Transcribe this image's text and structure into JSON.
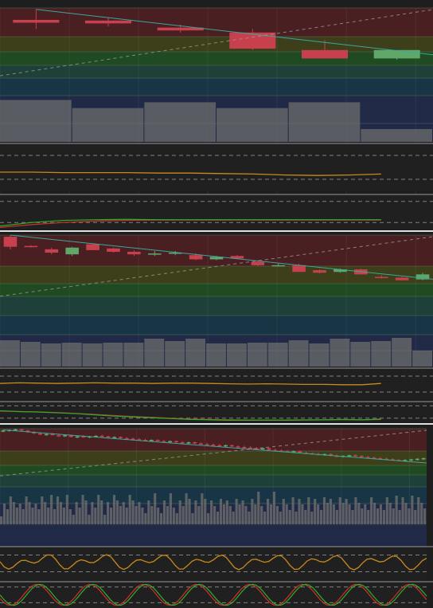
{
  "theme": {
    "background": "#1e1e1e",
    "divider": "#e0e0e0",
    "bull": "#5fa86a",
    "bear": "#c8404e",
    "trend_line": "#3aa79c",
    "ray_line": "#9a9a9a",
    "oscillator": "#c98a1c",
    "signal_red": "#d0302c",
    "signal_green": "#2fae2a",
    "volume_up": "#6e6e6e",
    "volume_down": "#3a3a4a",
    "zone_colors": [
      "#4a1f22",
      "#3d3f1a",
      "#1f4a22",
      "#1e4038",
      "#173545",
      "#202a46"
    ]
  },
  "chart_data": [
    {
      "name": "panel-1",
      "type": "candlestick",
      "period": "long",
      "price_range": [
        0,
        100
      ],
      "candles": [
        {
          "o": 83,
          "h": 98,
          "l": 70,
          "c": 79
        },
        {
          "o": 82,
          "h": 87,
          "l": 74,
          "c": 78
        },
        {
          "o": 72,
          "h": 76,
          "l": 65,
          "c": 68
        },
        {
          "o": 65,
          "h": 70,
          "l": 40,
          "c": 42
        },
        {
          "o": 40,
          "h": 54,
          "l": 28,
          "c": 28
        },
        {
          "o": 28,
          "h": 40,
          "l": 26,
          "c": 40
        }
      ],
      "volume": [
        72,
        58,
        68,
        58,
        68,
        22
      ],
      "oscillator": [
        40,
        40,
        39,
        39,
        39,
        38,
        38,
        37,
        36,
        34,
        33,
        34,
        36
      ],
      "signal_fast": [
        10,
        20,
        26,
        28,
        29,
        28,
        28,
        28,
        28,
        28,
        28,
        28,
        28
      ],
      "signal_slow": [
        6,
        14,
        20,
        24,
        26,
        27,
        27,
        27,
        27,
        27,
        27,
        27,
        27
      ]
    },
    {
      "name": "panel-2",
      "type": "candlestick",
      "period": "medium",
      "price_range": [
        0,
        100
      ],
      "candles": [
        {
          "o": 98,
          "h": 100,
          "l": 83,
          "c": 86
        },
        {
          "o": 87,
          "h": 88,
          "l": 85,
          "c": 86
        },
        {
          "o": 83,
          "h": 85,
          "l": 77,
          "c": 79
        },
        {
          "o": 77,
          "h": 86,
          "l": 75,
          "c": 85
        },
        {
          "o": 89,
          "h": 90,
          "l": 82,
          "c": 82
        },
        {
          "o": 84,
          "h": 85,
          "l": 79,
          "c": 80
        },
        {
          "o": 80,
          "h": 82,
          "l": 75,
          "c": 77
        },
        {
          "o": 78,
          "h": 81,
          "l": 75,
          "c": 78
        },
        {
          "o": 79,
          "h": 81,
          "l": 76,
          "c": 79
        },
        {
          "o": 76,
          "h": 78,
          "l": 70,
          "c": 71
        },
        {
          "o": 71,
          "h": 75,
          "l": 70,
          "c": 74
        },
        {
          "o": 75,
          "h": 76,
          "l": 71,
          "c": 72
        },
        {
          "o": 68,
          "h": 70,
          "l": 63,
          "c": 64
        },
        {
          "o": 64,
          "h": 66,
          "l": 63,
          "c": 64
        },
        {
          "o": 64,
          "h": 66,
          "l": 56,
          "c": 56
        },
        {
          "o": 58,
          "h": 59,
          "l": 54,
          "c": 55
        },
        {
          "o": 56,
          "h": 60,
          "l": 55,
          "c": 59
        },
        {
          "o": 59,
          "h": 60,
          "l": 53,
          "c": 53
        },
        {
          "o": 50,
          "h": 52,
          "l": 48,
          "c": 49
        },
        {
          "o": 49,
          "h": 50,
          "l": 46,
          "c": 46
        },
        {
          "o": 47,
          "h": 55,
          "l": 46,
          "c": 53
        }
      ],
      "volume": [
        66,
        62,
        58,
        60,
        58,
        60,
        60,
        70,
        64,
        70,
        58,
        58,
        60,
        60,
        66,
        58,
        70,
        62,
        64,
        72,
        40
      ],
      "oscillator": [
        52,
        54,
        53,
        52,
        53,
        54,
        53,
        53,
        52,
        53,
        53,
        52,
        51,
        50,
        51,
        50,
        49,
        49,
        48,
        48,
        52
      ],
      "signal_fast": [
        56,
        52,
        50,
        46,
        42,
        36,
        30,
        26,
        22,
        18,
        14,
        12,
        10,
        10,
        10,
        10,
        11,
        12,
        14,
        12,
        16
      ],
      "signal_slow": [
        54,
        52,
        50,
        47,
        43,
        38,
        33,
        28,
        24,
        20,
        16,
        14,
        12,
        11,
        11,
        11,
        12,
        12,
        13,
        12,
        14
      ]
    },
    {
      "name": "panel-3",
      "type": "candlestick",
      "period": "short",
      "price_range": [
        0,
        100
      ],
      "candles": [
        {
          "o": 96,
          "h": 98,
          "l": 94,
          "c": 97
        },
        {
          "o": 97,
          "h": 99,
          "l": 95,
          "c": 98
        },
        {
          "o": 98,
          "h": 100,
          "l": 96,
          "c": 99
        },
        {
          "o": 99,
          "h": 100,
          "l": 96,
          "c": 97
        },
        {
          "o": 97,
          "h": 98,
          "l": 93,
          "c": 94
        },
        {
          "o": 94,
          "h": 96,
          "l": 91,
          "c": 92
        },
        {
          "o": 92,
          "h": 94,
          "l": 89,
          "c": 90
        },
        {
          "o": 90,
          "h": 92,
          "l": 88,
          "c": 91
        },
        {
          "o": 91,
          "h": 93,
          "l": 89,
          "c": 89
        },
        {
          "o": 89,
          "h": 91,
          "l": 86,
          "c": 87
        },
        {
          "o": 87,
          "h": 90,
          "l": 86,
          "c": 89
        },
        {
          "o": 89,
          "h": 90,
          "l": 85,
          "c": 86
        },
        {
          "o": 86,
          "h": 88,
          "l": 84,
          "c": 87
        },
        {
          "o": 87,
          "h": 89,
          "l": 85,
          "c": 86
        },
        {
          "o": 86,
          "h": 88,
          "l": 84,
          "c": 87
        },
        {
          "o": 87,
          "h": 89,
          "l": 85,
          "c": 88
        },
        {
          "o": 88,
          "h": 90,
          "l": 86,
          "c": 87
        },
        {
          "o": 87,
          "h": 88,
          "l": 84,
          "c": 85
        },
        {
          "o": 85,
          "h": 87,
          "l": 83,
          "c": 86
        },
        {
          "o": 86,
          "h": 87,
          "l": 83,
          "c": 84
        },
        {
          "o": 84,
          "h": 86,
          "l": 82,
          "c": 83
        },
        {
          "o": 83,
          "h": 85,
          "l": 81,
          "c": 82
        },
        {
          "o": 82,
          "h": 84,
          "l": 80,
          "c": 81
        },
        {
          "o": 81,
          "h": 83,
          "l": 79,
          "c": 80
        },
        {
          "o": 80,
          "h": 82,
          "l": 78,
          "c": 81
        },
        {
          "o": 81,
          "h": 82,
          "l": 78,
          "c": 79
        },
        {
          "o": 79,
          "h": 81,
          "l": 77,
          "c": 78
        },
        {
          "o": 78,
          "h": 80,
          "l": 76,
          "c": 79
        },
        {
          "o": 79,
          "h": 80,
          "l": 76,
          "c": 77
        },
        {
          "o": 77,
          "h": 79,
          "l": 75,
          "c": 76
        },
        {
          "o": 76,
          "h": 78,
          "l": 74,
          "c": 77
        },
        {
          "o": 77,
          "h": 78,
          "l": 74,
          "c": 75
        },
        {
          "o": 75,
          "h": 77,
          "l": 73,
          "c": 74
        },
        {
          "o": 74,
          "h": 76,
          "l": 72,
          "c": 73
        },
        {
          "o": 73,
          "h": 75,
          "l": 71,
          "c": 72
        },
        {
          "o": 72,
          "h": 74,
          "l": 70,
          "c": 71
        },
        {
          "o": 71,
          "h": 73,
          "l": 69,
          "c": 72
        },
        {
          "o": 72,
          "h": 73,
          "l": 69,
          "c": 70
        },
        {
          "o": 70,
          "h": 72,
          "l": 68,
          "c": 69
        },
        {
          "o": 69,
          "h": 71,
          "l": 67,
          "c": 68
        },
        {
          "o": 68,
          "h": 70,
          "l": 66,
          "c": 67
        },
        {
          "o": 67,
          "h": 69,
          "l": 65,
          "c": 66
        },
        {
          "o": 66,
          "h": 68,
          "l": 64,
          "c": 67
        },
        {
          "o": 67,
          "h": 68,
          "l": 63,
          "c": 64
        },
        {
          "o": 64,
          "h": 66,
          "l": 62,
          "c": 63
        },
        {
          "o": 63,
          "h": 65,
          "l": 61,
          "c": 62
        },
        {
          "o": 62,
          "h": 64,
          "l": 60,
          "c": 61
        },
        {
          "o": 61,
          "h": 63,
          "l": 59,
          "c": 62
        },
        {
          "o": 62,
          "h": 63,
          "l": 58,
          "c": 59
        },
        {
          "o": 59,
          "h": 61,
          "l": 57,
          "c": 58
        },
        {
          "o": 58,
          "h": 60,
          "l": 56,
          "c": 57
        },
        {
          "o": 57,
          "h": 59,
          "l": 55,
          "c": 56
        },
        {
          "o": 56,
          "h": 58,
          "l": 54,
          "c": 57
        },
        {
          "o": 57,
          "h": 58,
          "l": 53,
          "c": 54
        },
        {
          "o": 54,
          "h": 56,
          "l": 52,
          "c": 53
        },
        {
          "o": 53,
          "h": 55,
          "l": 51,
          "c": 54
        },
        {
          "o": 54,
          "h": 56,
          "l": 52,
          "c": 55
        },
        {
          "o": 55,
          "h": 57,
          "l": 53,
          "c": 54
        },
        {
          "o": 54,
          "h": 55,
          "l": 51,
          "c": 52
        },
        {
          "o": 52,
          "h": 54,
          "l": 50,
          "c": 51
        },
        {
          "o": 51,
          "h": 53,
          "l": 49,
          "c": 50
        },
        {
          "o": 50,
          "h": 52,
          "l": 48,
          "c": 49
        },
        {
          "o": 49,
          "h": 51,
          "l": 47,
          "c": 48
        },
        {
          "o": 48,
          "h": 50,
          "l": 46,
          "c": 47
        },
        {
          "o": 47,
          "h": 49,
          "l": 45,
          "c": 46
        },
        {
          "o": 46,
          "h": 48,
          "l": 44,
          "c": 47
        },
        {
          "o": 47,
          "h": 49,
          "l": 45,
          "c": 48
        },
        {
          "o": 48,
          "h": 50,
          "l": 46,
          "c": 49
        },
        {
          "o": 49,
          "h": 51,
          "l": 47,
          "c": 50
        }
      ],
      "volume_bars": 136,
      "oscillator_shape": "choppy",
      "signal_shape": "stochastic"
    }
  ]
}
